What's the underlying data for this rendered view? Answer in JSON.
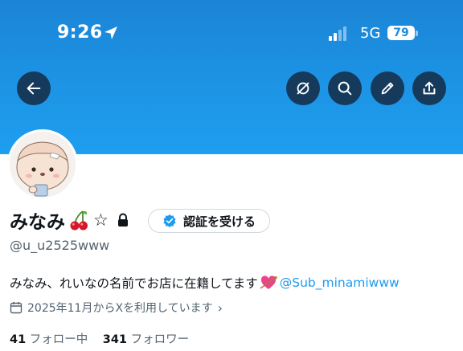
{
  "status_bar": {
    "time": "9:26",
    "network": "5G",
    "battery": "79"
  },
  "profile": {
    "name": "みなみ",
    "star": "☆",
    "verify_label": "認証を受ける",
    "handle": "@u_u2525www",
    "bio_text": "みなみ、れいなの名前でお店に在籍してます",
    "bio_mention": "@Sub_minamiwww",
    "joined": "2025年11月からXを利用しています",
    "following_count": "41",
    "following_label": "フォロー中",
    "followers_count": "341",
    "followers_label": "フォロワー"
  },
  "colors": {
    "banner": "#1d95e6",
    "accent": "#1d9bf0",
    "button_bg": "#163a5c"
  },
  "icons": [
    "back-arrow-icon",
    "grok-icon",
    "search-icon",
    "edit-icon",
    "share-icon",
    "lock-icon",
    "verified-badge-icon",
    "calendar-icon",
    "cherry-emoji-icon",
    "heart-arrow-emoji-icon"
  ]
}
